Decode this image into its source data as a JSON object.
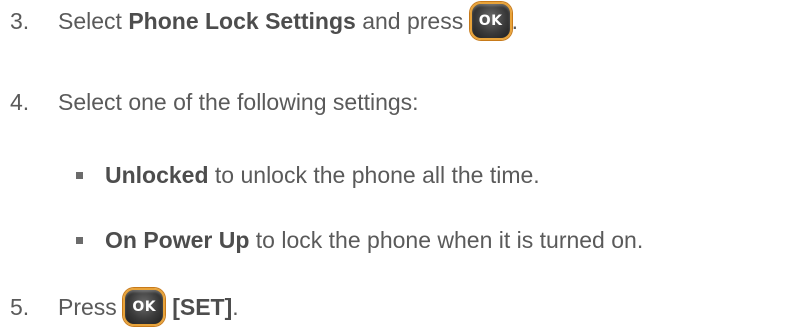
{
  "steps": [
    {
      "number": "3.",
      "text_before": "Select ",
      "bold": "Phone Lock Settings",
      "text_after": " and press ",
      "key_label": "OK",
      "end": "."
    },
    {
      "number": "4.",
      "text": "Select one of the following settings:"
    },
    {
      "number": "5.",
      "text_before": "Press ",
      "key_label": "OK",
      "bold": "[SET]",
      "end": "."
    }
  ],
  "options": [
    {
      "bold": "Unlocked",
      "text": " to unlock the phone all the time."
    },
    {
      "bold": "On Power Up",
      "text": " to lock the phone when it is turned on."
    }
  ]
}
